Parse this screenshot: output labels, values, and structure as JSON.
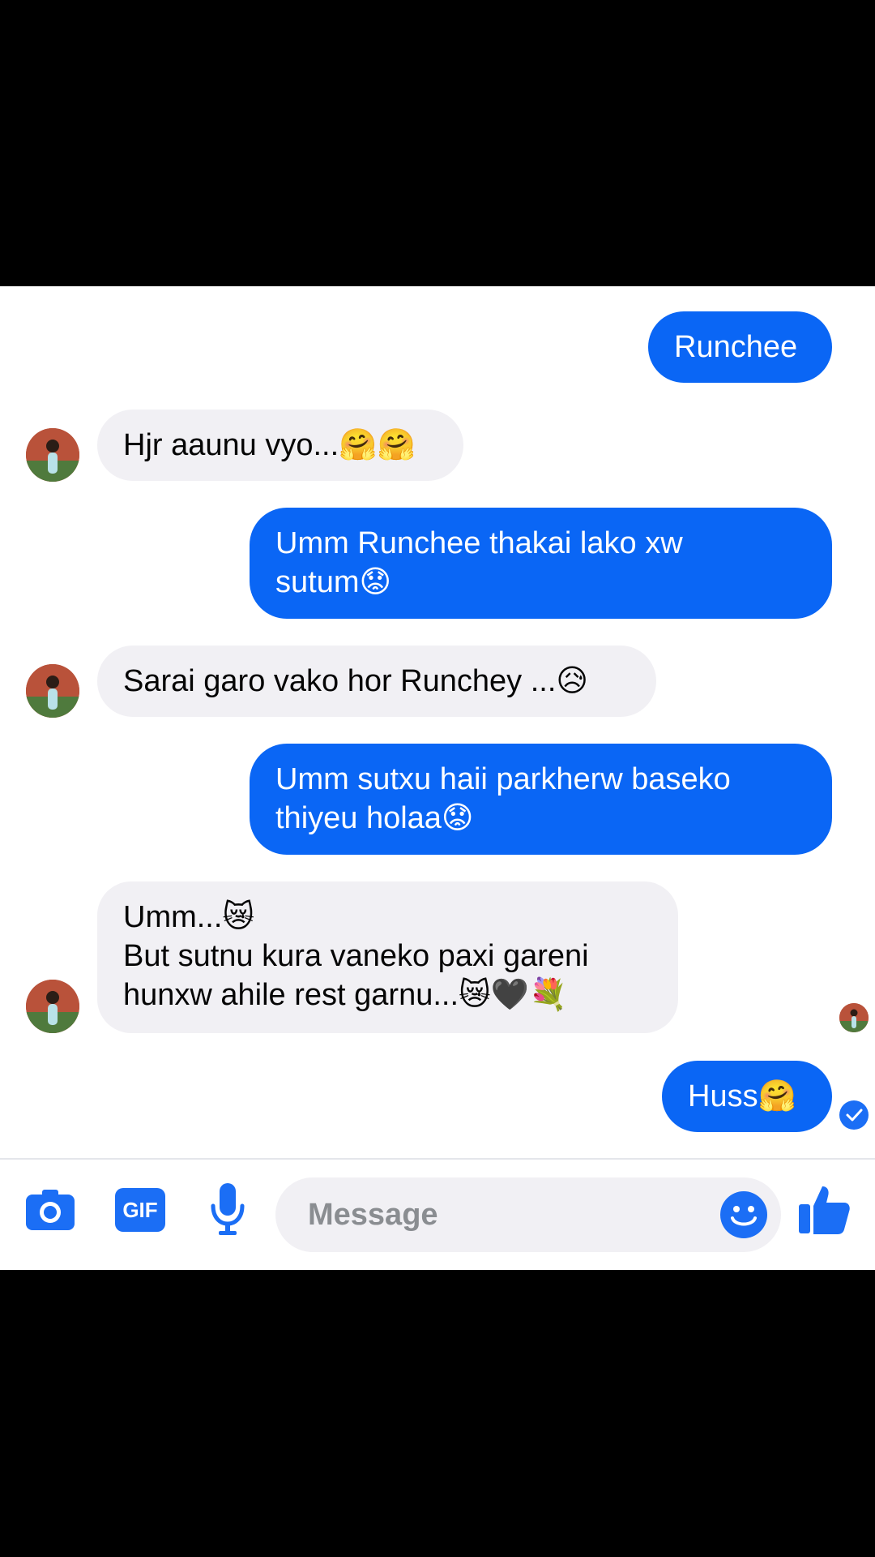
{
  "messages": [
    {
      "direction": "out",
      "text": "Runchee"
    },
    {
      "direction": "in",
      "text": "Hjr aaunu vyo...🤗🤗"
    },
    {
      "direction": "out",
      "line1": "Umm Runchee thakai lako xw",
      "line2": "sutum😟"
    },
    {
      "direction": "in",
      "text": "Sarai garo vako hor Runchey ...😥"
    },
    {
      "direction": "out",
      "line1": "Umm sutxu haii parkherw baseko",
      "line2": "thiyeu holaa😟"
    },
    {
      "direction": "in",
      "line1": "Umm...😿",
      "line2": "But sutnu kura vaneko paxi gareni",
      "line3": "hunxw ahile rest garnu...😿🖤💐"
    },
    {
      "direction": "out",
      "text": "Huss🤗"
    }
  ],
  "composer": {
    "placeholder": "Message",
    "gif_label": "GIF",
    "icons": [
      "camera-icon",
      "gif-icon",
      "microphone-icon",
      "emoji-icon",
      "thumbs-up-icon"
    ]
  },
  "colors": {
    "outgoing_bubble": "#0a66f5",
    "incoming_bubble": "#f1f0f4",
    "accent": "#1b6ef5"
  }
}
